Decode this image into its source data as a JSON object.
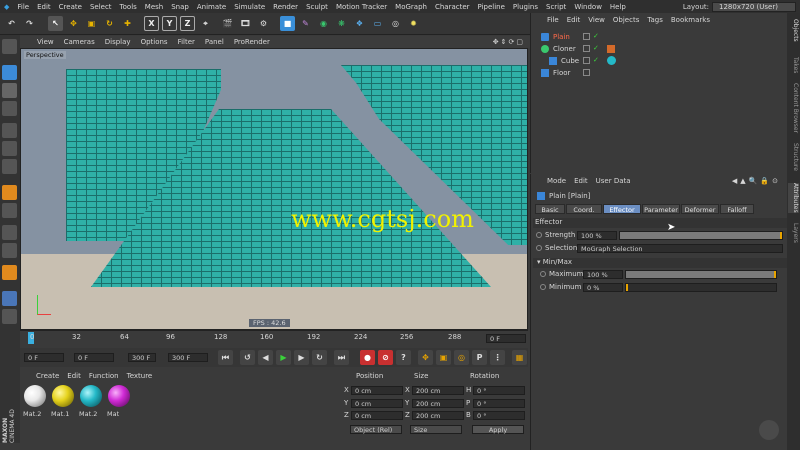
{
  "menubar": {
    "items": [
      "File",
      "Edit",
      "Create",
      "Select",
      "Tools",
      "Mesh",
      "Snap",
      "Animate",
      "Simulate",
      "Render",
      "Sculpt",
      "Motion Tracker",
      "MoGraph",
      "Character",
      "Pipeline",
      "Plugins",
      "Script",
      "Window",
      "Help"
    ],
    "layout_label": "Layout:",
    "layout_value": "1280x720 (User)"
  },
  "toolbar": {
    "axis_x": "X",
    "axis_y": "Y",
    "axis_z": "Z"
  },
  "viewport_menu": {
    "items": [
      "View",
      "Cameras",
      "Display",
      "Options",
      "Filter",
      "Panel",
      "ProRender"
    ]
  },
  "viewport": {
    "label": "Perspective",
    "fps": "FPS : 42.6",
    "watermark": "www.cgtsj.com"
  },
  "timeline": {
    "ticks": [
      "0",
      "32",
      "64",
      "96",
      "128",
      "160",
      "192",
      "224",
      "256",
      "288"
    ],
    "current_frame": "0 F"
  },
  "transport": {
    "start_frame": "0 F",
    "range_start": "0 F",
    "range_end": "300 F",
    "end_frame": "300 F"
  },
  "material_manager": {
    "menu": [
      "Create",
      "Edit",
      "Function",
      "Texture"
    ],
    "materials": [
      {
        "label": "Mat.2",
        "color": "#e8e8e8"
      },
      {
        "label": "Mat.1",
        "color": "#e5d21c"
      },
      {
        "label": "Mat.2",
        "color": "#24b9c8"
      },
      {
        "label": "Mat",
        "color": "#d02bd6"
      }
    ]
  },
  "coordinates": {
    "headers": [
      "Position",
      "Size",
      "Rotation"
    ],
    "rows": [
      {
        "axis": "X",
        "pos": "0 cm",
        "size_axis": "X",
        "size": "200 cm",
        "rot_axis": "H",
        "rot": "0 °"
      },
      {
        "axis": "Y",
        "pos": "0 cm",
        "size_axis": "Y",
        "size": "200 cm",
        "rot_axis": "P",
        "rot": "0 °"
      },
      {
        "axis": "Z",
        "pos": "0 cm",
        "size_axis": "Z",
        "size": "200 cm",
        "rot_axis": "B",
        "rot": "0 °"
      }
    ],
    "mode_select": "Object (Rel)",
    "size_select": "Size",
    "apply_label": "Apply"
  },
  "object_manager": {
    "menu": [
      "File",
      "Edit",
      "View",
      "Objects",
      "Tags",
      "Bookmarks"
    ],
    "objects": [
      {
        "name": "Plain",
        "color": "#ff6a4a"
      },
      {
        "name": "Cloner",
        "color": "#d6d6d6"
      },
      {
        "name": "Cube",
        "color": "#d6d6d6"
      },
      {
        "name": "Floor",
        "color": "#d6d6d6"
      }
    ]
  },
  "attribute_manager": {
    "menu": [
      "Mode",
      "Edit",
      "User Data"
    ],
    "object_title": "Plain [Plain]",
    "tabs": [
      "Basic",
      "Coord.",
      "Effector",
      "Parameter",
      "Deformer",
      "Falloff"
    ],
    "active_tab": "Effector",
    "section": "Effector",
    "strength_label": "Strength",
    "strength_value": "100 %",
    "strength_fraction": 1.0,
    "selection_label": "Selection",
    "selection_value": "MoGraph Selection",
    "minmax_label": "Min/Max",
    "maximum_label": "Maximum",
    "maximum_value": "100 %",
    "maximum_fraction": 1.0,
    "minimum_label": "Minimum",
    "minimum_value": "0 %",
    "minimum_fraction": 0.0
  },
  "right_tabs": [
    "Objects",
    "Takes",
    "Content Browser",
    "Structure",
    "Attributes",
    "Layers"
  ],
  "branding": {
    "logo_line1": "MAXON",
    "logo_line2": "CINEMA 4D"
  }
}
